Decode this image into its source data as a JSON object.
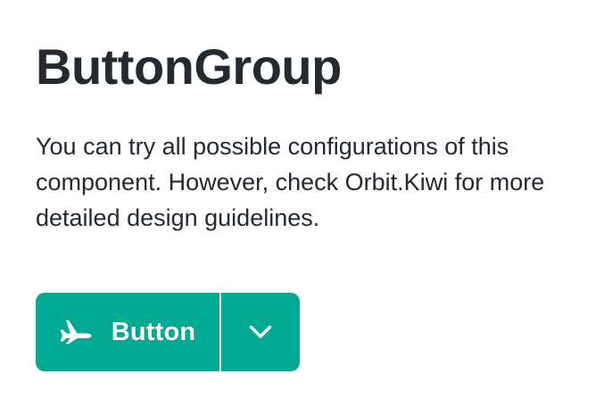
{
  "page": {
    "title": "ButtonGroup",
    "description": "You can try all possible configurations of this component. However, check Orbit.Kiwi for more detailed design guidelines."
  },
  "button_group": {
    "main_button": {
      "label": "Button",
      "icon": "airplane-icon"
    },
    "dropdown_button": {
      "icon": "chevron-down-icon"
    }
  },
  "colors": {
    "button_primary": "#00a991",
    "text_primary": "#252a31",
    "background": "#ffffff"
  }
}
